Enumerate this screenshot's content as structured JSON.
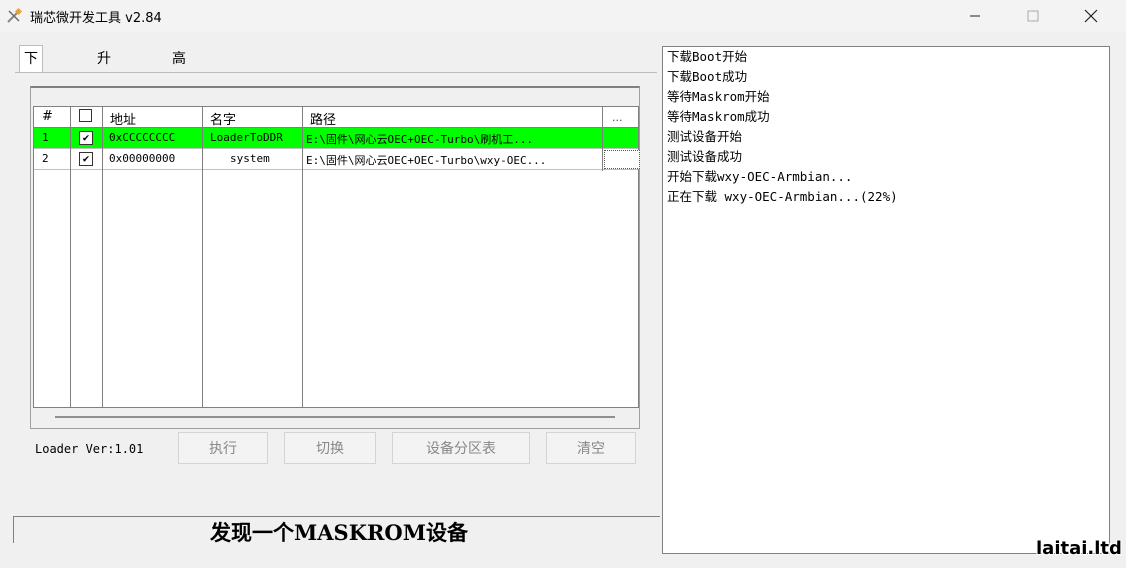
{
  "window": {
    "title": "瑞芯微开发工具 v2.84",
    "minimize_icon": "minimize-icon",
    "maximize_icon": "maximize-icon",
    "close_icon": "close-icon"
  },
  "tabs": [
    {
      "label": "下载镜像",
      "active": true
    },
    {
      "label": "升级固件",
      "active": false
    },
    {
      "label": "高级功能",
      "active": false
    }
  ],
  "table": {
    "headers": {
      "num": "#",
      "address": "地址",
      "name": "名字",
      "path": "路径",
      "more": "..."
    },
    "rows": [
      {
        "num": "1",
        "checked": "✔",
        "address": "0xCCCCCCCC",
        "name": "LoaderToDDR",
        "path": "E:\\固件\\网心云OEC+OEC-Turbo\\刷机工...",
        "selected": true
      },
      {
        "num": "2",
        "checked": "✔",
        "address": "0x00000000",
        "name": "system",
        "path": "E:\\固件\\网心云OEC+OEC-Turbo\\wxy-OEC...",
        "selected": false
      }
    ]
  },
  "loader_ver": "Loader Ver:1.01",
  "buttons": {
    "execute": "执行",
    "switch": "切换",
    "partition_table": "设备分区表",
    "clear": "清空"
  },
  "status": "发现一个MASKROM设备",
  "log": [
    "下载Boot开始",
    "下载Boot成功",
    "等待Maskrom开始",
    "等待Maskrom成功",
    "测试设备开始",
    "测试设备成功",
    "开始下载wxy-OEC-Armbian...",
    "正在下载 wxy-OEC-Armbian...(22%)"
  ],
  "watermark": "laitai.ltd",
  "colors": {
    "selected_row": "#00ff00"
  }
}
